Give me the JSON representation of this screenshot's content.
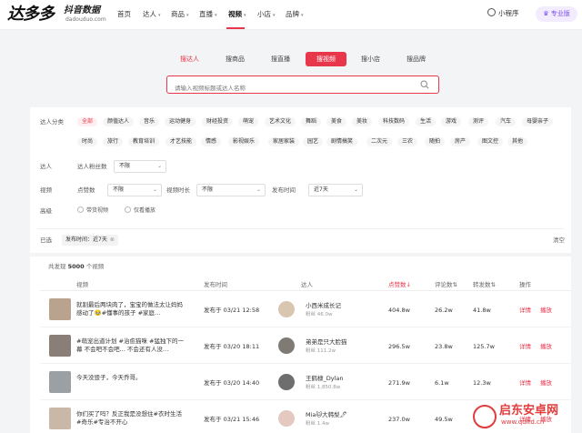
{
  "logo": {
    "main": "达多多",
    "sub": "抖音数据",
    "url": "dadouduo.com"
  },
  "nav": {
    "items": [
      {
        "label": "首页",
        "caret": false
      },
      {
        "label": "达人",
        "caret": true
      },
      {
        "label": "商品",
        "caret": true
      },
      {
        "label": "直播",
        "caret": true
      },
      {
        "label": "视频",
        "caret": true
      },
      {
        "label": "小店",
        "caret": true
      },
      {
        "label": "品牌",
        "caret": true
      }
    ],
    "mini_program": "小程序",
    "pro": "专业版"
  },
  "search": {
    "tabs": [
      "搜达人",
      "搜商品",
      "搜直播",
      "搜视频",
      "搜小店",
      "搜品牌"
    ],
    "active_tab": "搜视频",
    "placeholder": "请输入视频标题或达人名称"
  },
  "filters": {
    "category_label": "达人分类",
    "categories_row1": [
      "全部",
      "颜值达人",
      "音乐",
      "运动健身",
      "财经投资",
      "萌宠",
      "艺术文化",
      "舞蹈",
      "美食",
      "美妆",
      "科技数码",
      "生活",
      "游戏",
      "测评",
      "汽车",
      "母婴亲子"
    ],
    "categories_row2": [
      "时尚",
      "旅行",
      "教育培训",
      "才艺技能",
      "情感",
      "影视娱乐",
      "家居家装",
      "园艺",
      "剧情搞笑",
      "二次元",
      "三农",
      "随拍",
      "房产",
      "图文控",
      "其他"
    ],
    "kol_label": "达人",
    "fans_label": "达人粉丝数",
    "fans_value": "不限",
    "video_label": "视频",
    "likes_label": "点赞数",
    "likes_value": "不限",
    "duration_label": "视频时长",
    "duration_value": "不限",
    "time_label": "发布时间",
    "time_value": "近7天",
    "advanced_label": "高级",
    "radio1": "带货视频",
    "radio2": "仅看播放",
    "selected_label": "已选",
    "selected_tag": "发布时间：近7天",
    "clear": "清空"
  },
  "results": {
    "found_prefix": "共发现",
    "found_count": "5000",
    "found_suffix": "个视频",
    "columns": [
      "视频",
      "发布时间",
      "达人",
      "点赞数",
      "评论数",
      "转发数",
      "操作"
    ],
    "rows": [
      {
        "title": "就割最后两块肉了，宝宝的做法太让妈妈感动了🥹#懂事的孩子 #家庭…",
        "time": "发布于 03/21 12:58",
        "kol": "小西米成长记",
        "fans": "粉丝 46.0w",
        "likes": "404.8w",
        "comments": "26.2w",
        "shares": "41.8w",
        "detail": "详情",
        "play": "播放"
      },
      {
        "title": "#萌宠出道计划 #治愈猫咪 #猛独下的一幕 不会吧不会吧... 不会还有人没…",
        "time": "发布于 03/20 18:11",
        "kol": "弟弟是只大脸猫",
        "fans": "粉丝 111.2w",
        "likes": "296.5w",
        "comments": "23.8w",
        "shares": "125.7w",
        "detail": "详情",
        "play": "播放"
      },
      {
        "title": "今天没毁子，今天乔哥。",
        "time": "发布于 03/20 14:40",
        "kol": "王鹤棣_Dylan",
        "fans": "粉丝 1,850.8w",
        "likes": "271.9w",
        "comments": "6.1w",
        "shares": "12.3w",
        "detail": "详情",
        "play": "播放"
      },
      {
        "title": "你们买了吗？反正我是没想住#衣时生活 #奇乐#专治不开心",
        "time": "发布于 03/21 15:46",
        "kol": "Mia🐱大韩梨🖊",
        "fans": "粉丝 1.4w",
        "likes": "237.0w",
        "comments": "49.5w",
        "shares": "",
        "detail": "详情",
        "play": "播放"
      }
    ]
  },
  "watermark": {
    "title": "启东安卓网",
    "url": "www.qdltd.cn"
  },
  "colors": {
    "accent": "#e8364b",
    "pro": "#7a4ee8"
  }
}
